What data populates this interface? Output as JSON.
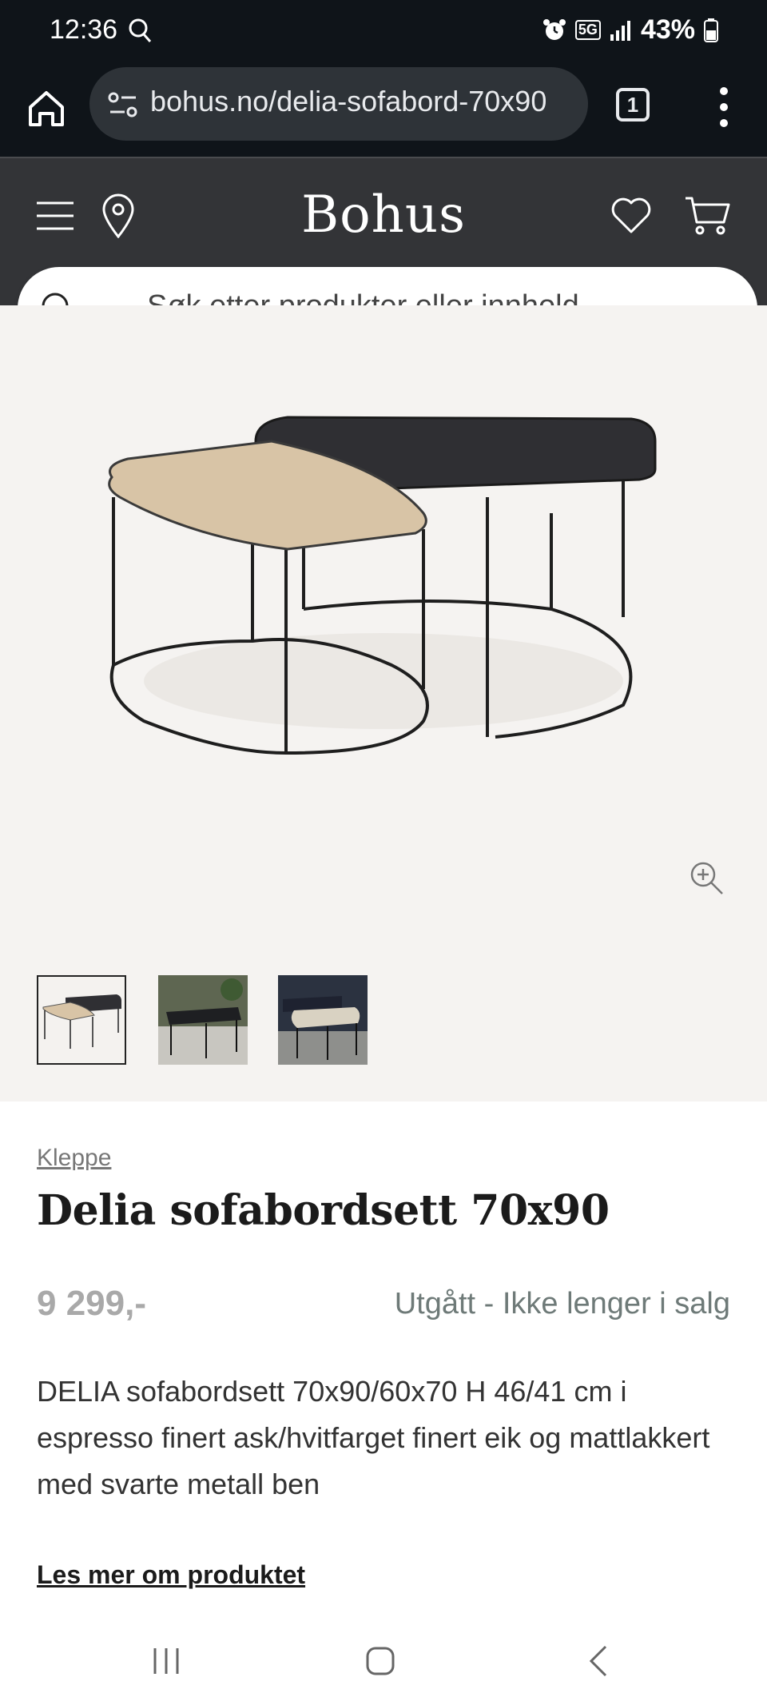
{
  "status_bar": {
    "time": "12:36",
    "network": "5G",
    "battery": "43%"
  },
  "browser": {
    "url": "bohus.no/delia-sofabord-70x90",
    "tab_count": "1"
  },
  "header": {
    "logo": "Bohus"
  },
  "search": {
    "placeholder": "Søk etter produkter eller innhold..."
  },
  "product": {
    "brand": "Kleppe",
    "title": "Delia sofabordsett 70x90",
    "price": "9 299,-",
    "availability": "Utgått - Ikke lenger i salg",
    "description": "DELIA sofabordsett 70x90/60x70 H 46/41 cm i espresso finert ask/hvitfarget finert eik og mattlakkert med svarte metall ben",
    "read_more": "Les mer om produktet"
  },
  "colors": {
    "status_bg": "#0f1419",
    "header_bg": "#333437",
    "gallery_bg": "#f5f3f1",
    "price_gray": "#a9a9a9",
    "availability": "#6e7a78"
  }
}
